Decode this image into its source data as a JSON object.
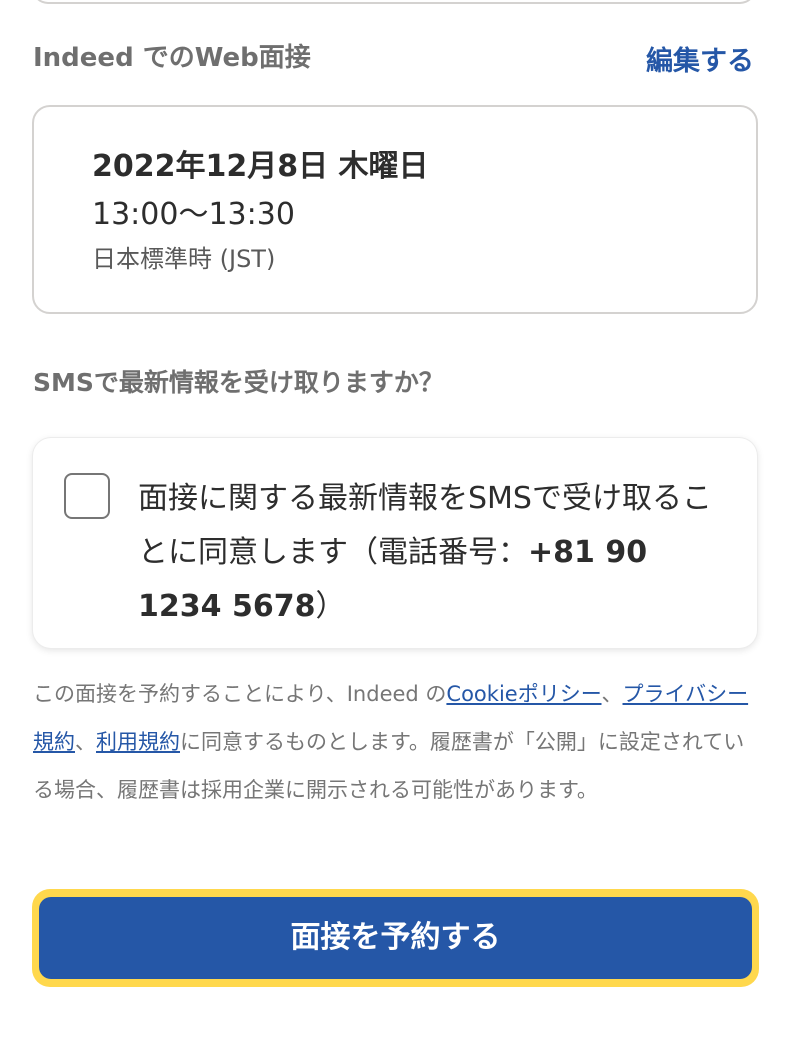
{
  "interview_section": {
    "title": "Indeed でのWeb面接",
    "edit_label": "編集する"
  },
  "schedule": {
    "date": "2022年12月8日 木曜日",
    "time": "13:00〜13:30",
    "timezone": "日本標準時 (JST)"
  },
  "sms": {
    "question": "SMSで最新情報を受け取りますか？",
    "checked": false,
    "label_prefix": "面接に関する最新情報をSMSで受け取ることに同意します（電話番号：",
    "phone": "+81 90 1234 5678",
    "label_suffix": "）"
  },
  "disclaimer": {
    "text_1": "この面接を予約することにより、Indeed の",
    "link_cookie": "Cookieポリシー",
    "sep_1": "、",
    "link_privacy": "プライバシー規約",
    "sep_2": "、",
    "link_terms": "利用規約",
    "text_2": "に同意するものとします。履歴書が「公開」に設定されている場合、履歴書は採用企業に開示される可能性があります。"
  },
  "submit": {
    "label": "面接を予約する"
  },
  "colors": {
    "accent": "#2557a7",
    "focus_ring": "#ffd84d"
  }
}
